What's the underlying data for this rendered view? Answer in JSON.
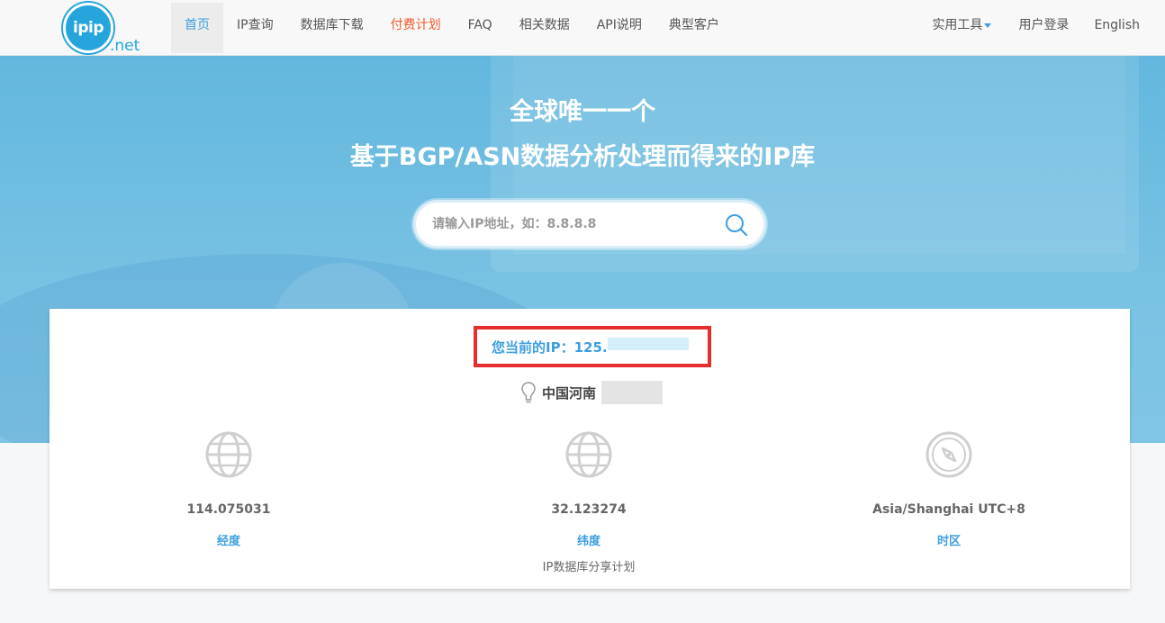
{
  "brand": {
    "logo_text": "ipip",
    "logo_suffix": ".net"
  },
  "nav": {
    "items": [
      {
        "label": "首页"
      },
      {
        "label": "IP查询"
      },
      {
        "label": "数据库下载"
      },
      {
        "label": "付费计划"
      },
      {
        "label": "FAQ"
      },
      {
        "label": "相关数据"
      },
      {
        "label": "API说明"
      },
      {
        "label": "典型客户"
      }
    ],
    "right": [
      {
        "label": "实用工具"
      },
      {
        "label": "用户登录"
      },
      {
        "label": "English"
      }
    ],
    "active_index": 0
  },
  "hero": {
    "title_line1": "全球唯一一个",
    "title_line2": "基于BGP/ASN数据分析处理而得来的IP库",
    "search_placeholder": "请输入IP地址，如：8.8.8.8"
  },
  "info": {
    "current_ip_text": "您当前的IP：125.",
    "location_text": "中国河南",
    "stats": [
      {
        "value": "114.075031",
        "label": "经度",
        "icon": "globe-icon"
      },
      {
        "value": "32.123274",
        "label": "纬度",
        "note": "IP数据库分享计划",
        "icon": "globe-icon"
      },
      {
        "value": "Asia/Shanghai UTC+8",
        "label": "时区",
        "icon": "compass-icon"
      }
    ]
  },
  "colors": {
    "accent": "#3d9fe0",
    "paid": "#f05a2a",
    "highlight_border": "#e62e2e",
    "hero": "#6bbbe0"
  }
}
